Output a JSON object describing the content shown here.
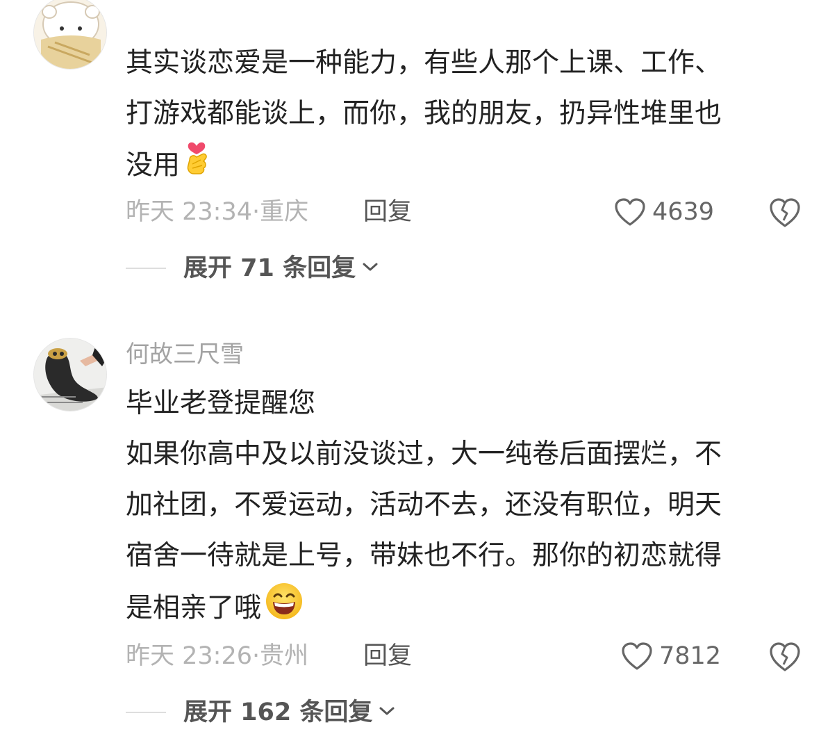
{
  "comments": [
    {
      "username": "",
      "lines": [
        "其实谈恋爱是一种能力，有些人那个上课、工作、",
        "打游戏都能谈上，而你，我的朋友，扔异性堆里也",
        "没用"
      ],
      "emoji": "finger-heart-emoji",
      "time": "昨天 23:34·重庆",
      "reply_label": "回复",
      "likes": "4639",
      "expand_label": "展开 71 条回复"
    },
    {
      "username": "何故三尺雪",
      "lines": [
        "毕业老登提醒您",
        "如果你高中及以前没谈过，大一纯卷后面摆烂，不",
        "加社团，不爱运动，活动不去，还没有职位，明天",
        "宿舍一待就是上号，带妹也不行。那你的初恋就得",
        "是相亲了哦"
      ],
      "emoji": "grinning-face-emoji",
      "time": "昨天 23:26·贵州",
      "reply_label": "回复",
      "likes": "7812",
      "expand_label": "展开 162 条回复"
    }
  ],
  "colors": {
    "text": "#222222",
    "meta": "#b3b3b3",
    "secondary": "#555555",
    "username": "#a3a3a3"
  }
}
